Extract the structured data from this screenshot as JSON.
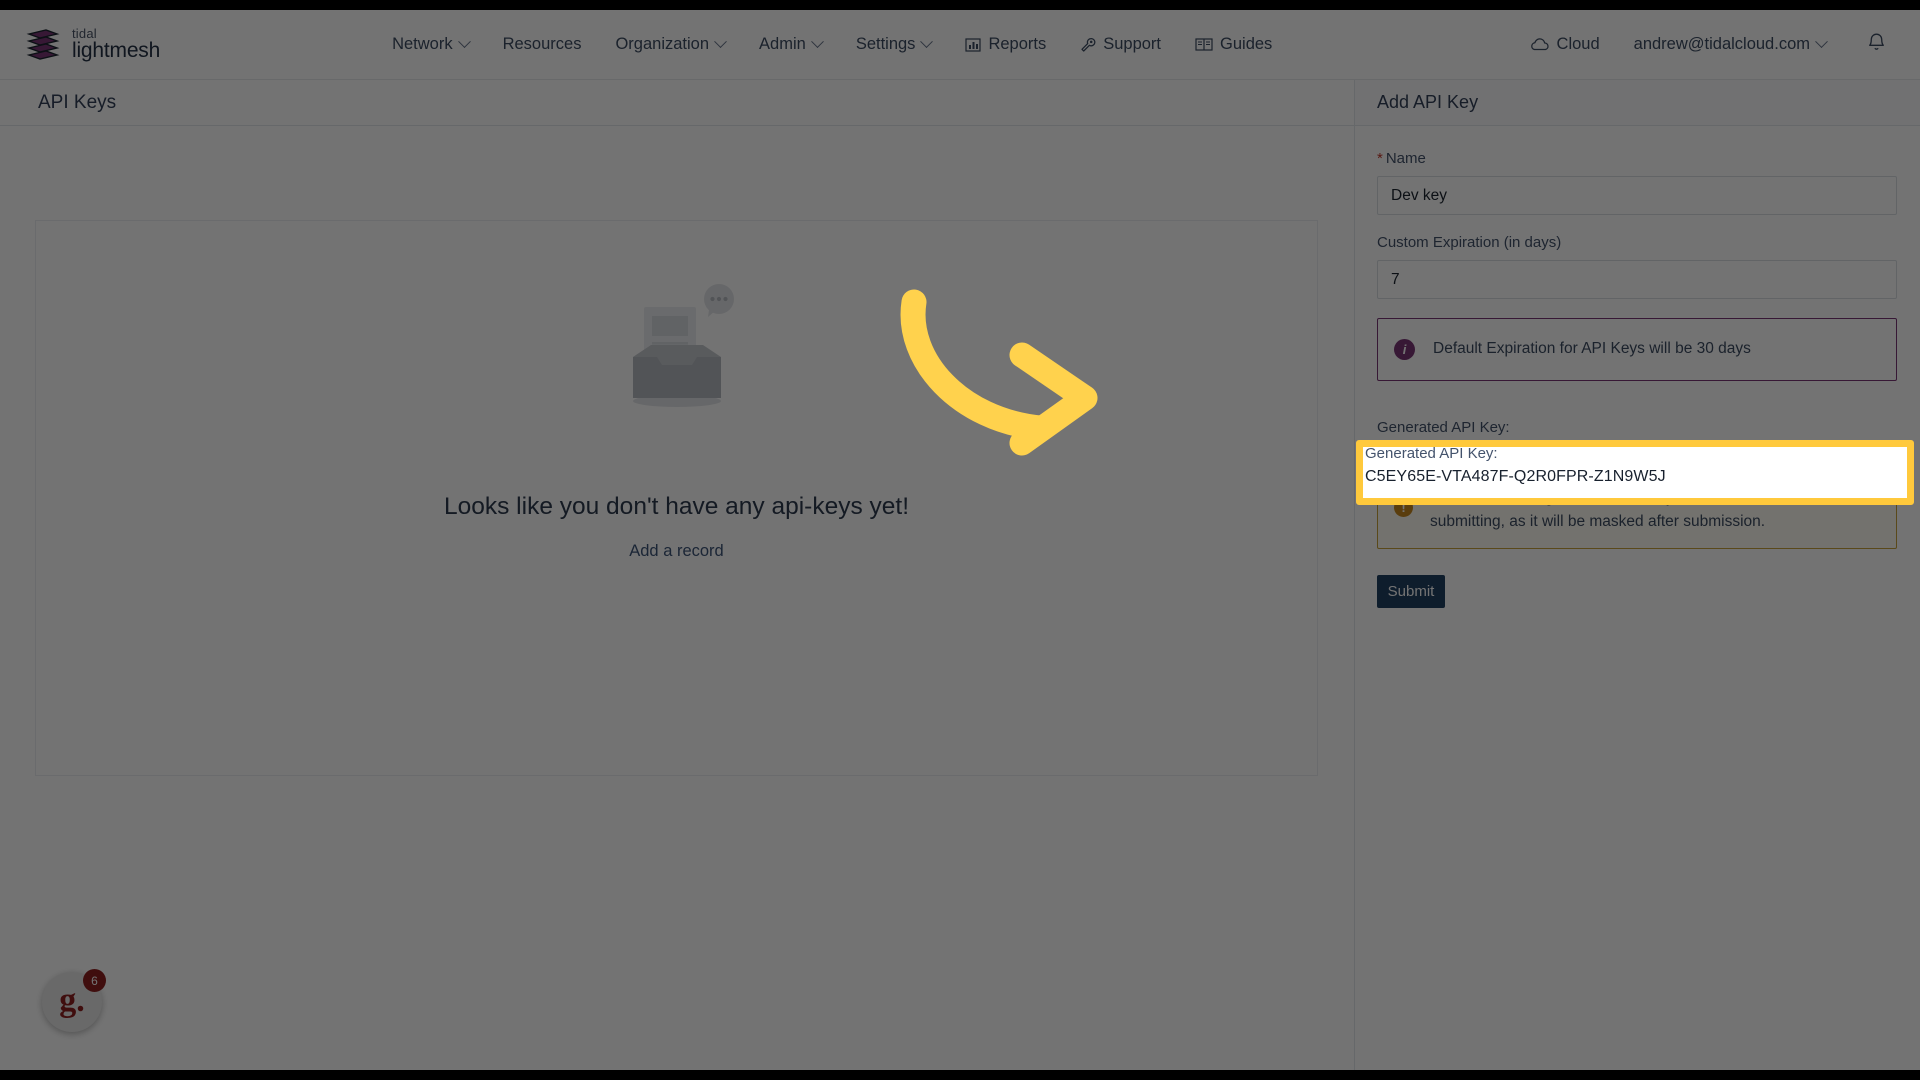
{
  "brand": {
    "top": "tidal",
    "bottom": "lightmesh",
    "logo_icon": "tidal-lightmesh-logo"
  },
  "nav": {
    "items": [
      {
        "label": "Network",
        "caret": true,
        "icon": null
      },
      {
        "label": "Resources",
        "caret": false,
        "icon": null
      },
      {
        "label": "Organization",
        "caret": true,
        "icon": null
      },
      {
        "label": "Admin",
        "caret": true,
        "icon": null
      },
      {
        "label": "Settings",
        "caret": true,
        "icon": null
      },
      {
        "label": "Reports",
        "caret": false,
        "icon": "chart-bar-icon"
      },
      {
        "label": "Support",
        "caret": false,
        "icon": "wrench-icon"
      },
      {
        "label": "Guides",
        "caret": false,
        "icon": "book-icon"
      }
    ],
    "cloud": {
      "label": "Cloud",
      "icon": "cloud-icon"
    },
    "account": {
      "label": "andrew@tidalcloud.com",
      "caret": true
    },
    "notifications_icon": "bell-icon"
  },
  "page": {
    "title": "API Keys"
  },
  "empty_state": {
    "illustration_icon": "empty-inbox-icon",
    "message": "Looks like you don't have any api-keys yet!",
    "link": "Add a record"
  },
  "drawer": {
    "title": "Add API Key",
    "name_field": {
      "label": "Name",
      "required_marker": "*",
      "value": "Dev key"
    },
    "expiration_field": {
      "label": "Custom Expiration (in days)",
      "value": "7"
    },
    "info_alert": {
      "icon": "info-icon",
      "text": "Default Expiration for API Keys will be 30 days"
    },
    "generated_key": {
      "label": "Generated API Key:",
      "value": "C5EY65E-VTA487F-Q2R0FPR-Z1N9W5J"
    },
    "warning_alert": {
      "icon": "warning-icon",
      "text": "Please save the generated API Key somewhere safe before submitting, as it will be masked after submission."
    },
    "submit_label": "Submit"
  },
  "chat_widget": {
    "logo": "g.",
    "badge_count": "6"
  },
  "annotation": {
    "highlight_color": "#ffc93c",
    "arrow_color": "#ffd24d",
    "arrow_icon": "curved-arrow-right-icon"
  },
  "colors": {
    "brand_purple": "#7b3576",
    "primary_button": "#214263",
    "text_dark": "#33415a",
    "warning": "#c8881e",
    "required": "#c0392b"
  }
}
